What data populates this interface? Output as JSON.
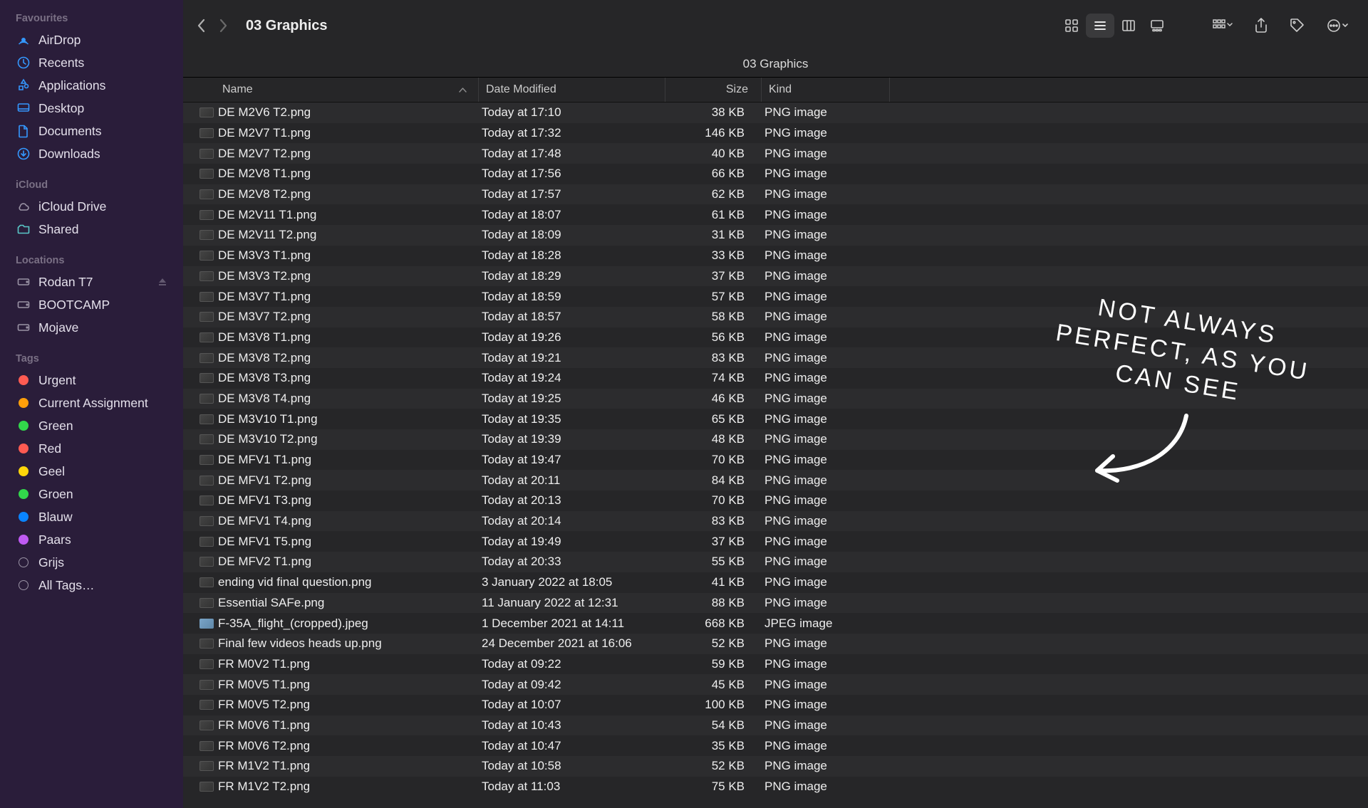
{
  "window_title": "03 Graphics",
  "path_bar": "03 Graphics",
  "sidebar": {
    "sections": [
      {
        "title": "Favourites",
        "items": [
          {
            "label": "AirDrop",
            "icon": "airdrop",
            "color": "#3498ff"
          },
          {
            "label": "Recents",
            "icon": "clock",
            "color": "#3498ff"
          },
          {
            "label": "Applications",
            "icon": "apps",
            "color": "#3498ff"
          },
          {
            "label": "Desktop",
            "icon": "desktop",
            "color": "#3498ff"
          },
          {
            "label": "Documents",
            "icon": "doc",
            "color": "#3498ff"
          },
          {
            "label": "Downloads",
            "icon": "download",
            "color": "#3498ff"
          }
        ]
      },
      {
        "title": "iCloud",
        "items": [
          {
            "label": "iCloud Drive",
            "icon": "cloud",
            "color": "#9a93a5"
          },
          {
            "label": "Shared",
            "icon": "shared",
            "color": "#5ac8c8"
          }
        ]
      },
      {
        "title": "Locations",
        "items": [
          {
            "label": "Rodan T7",
            "icon": "hdd",
            "color": "#9a93a5",
            "eject": true
          },
          {
            "label": "BOOTCAMP",
            "icon": "hdd",
            "color": "#9a93a5"
          },
          {
            "label": "Mojave",
            "icon": "hdd",
            "color": "#9a93a5"
          }
        ]
      },
      {
        "title": "Tags",
        "items": [
          {
            "label": "Urgent",
            "tag_color": "#ff5b52"
          },
          {
            "label": "Current Assignment",
            "tag_color": "#ff9f0a"
          },
          {
            "label": "Green",
            "tag_color": "#32d74b"
          },
          {
            "label": "Red",
            "tag_color": "#ff5b52"
          },
          {
            "label": "Geel",
            "tag_color": "#ffd60a"
          },
          {
            "label": "Groen",
            "tag_color": "#32d74b"
          },
          {
            "label": "Blauw",
            "tag_color": "#0a84ff"
          },
          {
            "label": "Paars",
            "tag_color": "#bf5af2"
          },
          {
            "label": "Grijs",
            "tag_outline": true
          },
          {
            "label": "All Tags…",
            "tag_outline": true
          }
        ]
      }
    ]
  },
  "columns": {
    "name": "Name",
    "date": "Date Modified",
    "size": "Size",
    "kind": "Kind"
  },
  "files": [
    {
      "name": "DE M2V6 T2.png",
      "date": "Today at 17:10",
      "size": "38 KB",
      "kind": "PNG image",
      "thumb": "png"
    },
    {
      "name": "DE M2V7 T1.png",
      "date": "Today at 17:32",
      "size": "146 KB",
      "kind": "PNG image",
      "thumb": "png"
    },
    {
      "name": "DE M2V7 T2.png",
      "date": "Today at 17:48",
      "size": "40 KB",
      "kind": "PNG image",
      "thumb": "png"
    },
    {
      "name": "DE M2V8 T1.png",
      "date": "Today at 17:56",
      "size": "66 KB",
      "kind": "PNG image",
      "thumb": "png"
    },
    {
      "name": "DE M2V8 T2.png",
      "date": "Today at 17:57",
      "size": "62 KB",
      "kind": "PNG image",
      "thumb": "png"
    },
    {
      "name": "DE M2V11 T1.png",
      "date": "Today at 18:07",
      "size": "61 KB",
      "kind": "PNG image",
      "thumb": "png"
    },
    {
      "name": "DE M2V11 T2.png",
      "date": "Today at 18:09",
      "size": "31 KB",
      "kind": "PNG image",
      "thumb": "png"
    },
    {
      "name": "DE M3V3 T1.png",
      "date": "Today at 18:28",
      "size": "33 KB",
      "kind": "PNG image",
      "thumb": "png"
    },
    {
      "name": "DE M3V3 T2.png",
      "date": "Today at 18:29",
      "size": "37 KB",
      "kind": "PNG image",
      "thumb": "png"
    },
    {
      "name": "DE M3V7 T1.png",
      "date": "Today at 18:59",
      "size": "57 KB",
      "kind": "PNG image",
      "thumb": "png"
    },
    {
      "name": "DE M3V7 T2.png",
      "date": "Today at 18:57",
      "size": "58 KB",
      "kind": "PNG image",
      "thumb": "png"
    },
    {
      "name": "DE M3V8 T1.png",
      "date": "Today at 19:26",
      "size": "56 KB",
      "kind": "PNG image",
      "thumb": "png"
    },
    {
      "name": "DE M3V8 T2.png",
      "date": "Today at 19:21",
      "size": "83 KB",
      "kind": "PNG image",
      "thumb": "png"
    },
    {
      "name": "DE M3V8 T3.png",
      "date": "Today at 19:24",
      "size": "74 KB",
      "kind": "PNG image",
      "thumb": "png"
    },
    {
      "name": "DE M3V8 T4.png",
      "date": "Today at 19:25",
      "size": "46 KB",
      "kind": "PNG image",
      "thumb": "png"
    },
    {
      "name": "DE M3V10 T1.png",
      "date": "Today at 19:35",
      "size": "65 KB",
      "kind": "PNG image",
      "thumb": "png"
    },
    {
      "name": "DE M3V10 T2.png",
      "date": "Today at 19:39",
      "size": "48 KB",
      "kind": "PNG image",
      "thumb": "png"
    },
    {
      "name": "DE MFV1 T1.png",
      "date": "Today at 19:47",
      "size": "70 KB",
      "kind": "PNG image",
      "thumb": "png"
    },
    {
      "name": "DE MFV1 T2.png",
      "date": "Today at 20:11",
      "size": "84 KB",
      "kind": "PNG image",
      "thumb": "png"
    },
    {
      "name": "DE MFV1 T3.png",
      "date": "Today at 20:13",
      "size": "70 KB",
      "kind": "PNG image",
      "thumb": "png"
    },
    {
      "name": "DE MFV1 T4.png",
      "date": "Today at 20:14",
      "size": "83 KB",
      "kind": "PNG image",
      "thumb": "png"
    },
    {
      "name": "DE MFV1 T5.png",
      "date": "Today at 19:49",
      "size": "37 KB",
      "kind": "PNG image",
      "thumb": "png"
    },
    {
      "name": "DE MFV2 T1.png",
      "date": "Today at 20:33",
      "size": "55 KB",
      "kind": "PNG image",
      "thumb": "png"
    },
    {
      "name": "ending vid final question.png",
      "date": "3 January 2022 at 18:05",
      "size": "41 KB",
      "kind": "PNG image",
      "thumb": "png"
    },
    {
      "name": "Essential SAFe.png",
      "date": "11 January 2022 at 12:31",
      "size": "88 KB",
      "kind": "PNG image",
      "thumb": "png"
    },
    {
      "name": "F-35A_flight_(cropped).jpeg",
      "date": "1 December 2021 at 14:11",
      "size": "668 KB",
      "kind": "JPEG image",
      "thumb": "jpeg"
    },
    {
      "name": "Final few videos heads up.png",
      "date": "24 December 2021 at 16:06",
      "size": "52 KB",
      "kind": "PNG image",
      "thumb": "png"
    },
    {
      "name": "FR M0V2 T1.png",
      "date": "Today at 09:22",
      "size": "59 KB",
      "kind": "PNG image",
      "thumb": "png"
    },
    {
      "name": "FR M0V5 T1.png",
      "date": "Today at 09:42",
      "size": "45 KB",
      "kind": "PNG image",
      "thumb": "png"
    },
    {
      "name": "FR M0V5 T2.png",
      "date": "Today at 10:07",
      "size": "100 KB",
      "kind": "PNG image",
      "thumb": "png"
    },
    {
      "name": "FR M0V6 T1.png",
      "date": "Today at 10:43",
      "size": "54 KB",
      "kind": "PNG image",
      "thumb": "png"
    },
    {
      "name": "FR M0V6 T2.png",
      "date": "Today at 10:47",
      "size": "35 KB",
      "kind": "PNG image",
      "thumb": "png"
    },
    {
      "name": "FR M1V2 T1.png",
      "date": "Today at 10:58",
      "size": "52 KB",
      "kind": "PNG image",
      "thumb": "png"
    },
    {
      "name": "FR M1V2 T2.png",
      "date": "Today at 11:03",
      "size": "75 KB",
      "kind": "PNG image",
      "thumb": "png"
    }
  ],
  "annotation": {
    "line1": "NOT ALWAYS",
    "line2": "PERFECT, AS YOU",
    "line3": "CAN SEE"
  }
}
